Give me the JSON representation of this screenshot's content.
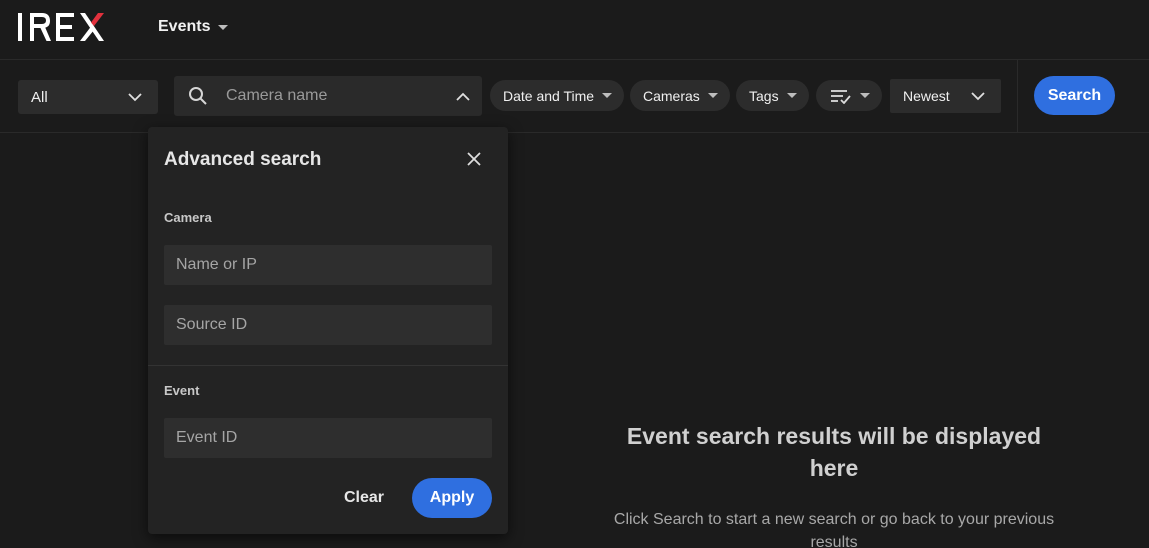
{
  "app": {
    "logo_text": "IREX",
    "nav_label": "Events"
  },
  "filters": {
    "type_select": "All",
    "camera_search_placeholder": "Camera name",
    "chips": [
      {
        "label": "Date and Time"
      },
      {
        "label": "Cameras"
      },
      {
        "label": "Tags"
      }
    ],
    "sort_value": "Newest",
    "search_label": "Search"
  },
  "advanced_search": {
    "title": "Advanced search",
    "camera_section": "Camera",
    "name_or_ip_placeholder": "Name or IP",
    "source_id_placeholder": "Source ID",
    "event_section": "Event",
    "event_id_placeholder": "Event ID",
    "clear_label": "Clear",
    "apply_label": "Apply"
  },
  "empty_state": {
    "title": "Event search results will be displayed here",
    "subtitle": "Click Search to start a new search or go back to your previous results"
  },
  "colors": {
    "background": "#1b1b1b",
    "accent": "#2f6fe0",
    "logo_x_accent": "#e2313d"
  },
  "icons": [
    "search-icon",
    "chevron-up-icon",
    "chevron-down-icon",
    "filter-check-icon",
    "close-icon"
  ]
}
